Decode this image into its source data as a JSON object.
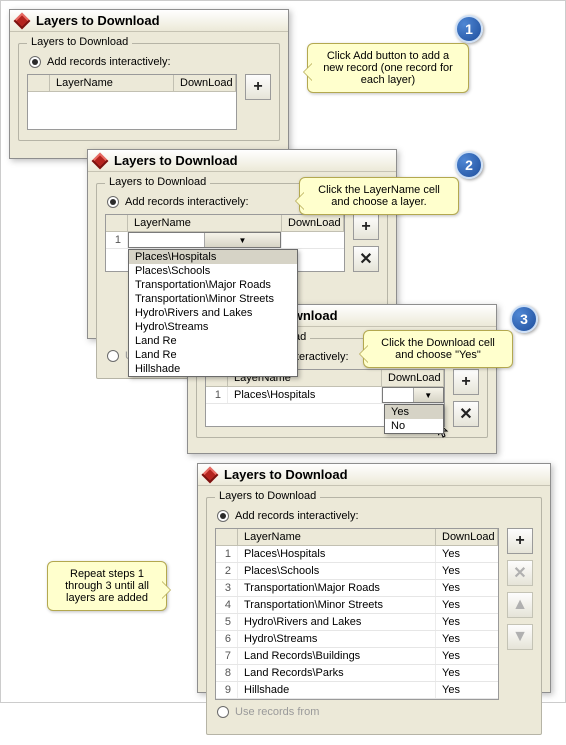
{
  "dialog_title": "Layers to Download",
  "group_label": "Layers to Download",
  "radio_add_label": "Add records interactively:",
  "radio_use_label": "Use records from",
  "columns": {
    "layer": "LayerName",
    "download": "DownLoad"
  },
  "buttons": {
    "add": "+",
    "delete": "✕",
    "up": "▲",
    "down": "▼"
  },
  "steps": {
    "s1": {
      "num": "1",
      "callout": "Click Add button to add a new record (one record for each layer)"
    },
    "s2": {
      "num": "2",
      "callout": "Click the LayerName cell and choose a layer."
    },
    "s3": {
      "num": "3",
      "callout": "Click the Download cell and choose \"Yes\""
    },
    "s4": {
      "callout": "Repeat steps 1 through 3 until all layers are added"
    }
  },
  "layer_dropdown": {
    "options": [
      "Places\\Hospitals",
      "Places\\Schools",
      "Transportation\\Major Roads",
      "Transportation\\Minor Streets",
      "Hydro\\Rivers and Lakes",
      "Hydro\\Streams",
      "Land Re",
      "Land Re",
      "Hillshade"
    ]
  },
  "download_dropdown": {
    "options": [
      "Yes",
      "No"
    ]
  },
  "step3_row": {
    "num": "1",
    "layer": "Places\\Hospitals",
    "download": ""
  },
  "final_rows": [
    {
      "num": "1",
      "layer": "Places\\Hospitals",
      "download": "Yes"
    },
    {
      "num": "2",
      "layer": "Places\\Schools",
      "download": "Yes"
    },
    {
      "num": "3",
      "layer": "Transportation\\Major Roads",
      "download": "Yes"
    },
    {
      "num": "4",
      "layer": "Transportation\\Minor Streets",
      "download": "Yes"
    },
    {
      "num": "5",
      "layer": "Hydro\\Rivers and Lakes",
      "download": "Yes"
    },
    {
      "num": "6",
      "layer": "Hydro\\Streams",
      "download": "Yes"
    },
    {
      "num": "7",
      "layer": "Land Records\\Buildings",
      "download": "Yes"
    },
    {
      "num": "8",
      "layer": "Land Records\\Parks",
      "download": "Yes"
    },
    {
      "num": "9",
      "layer": "Hillshade",
      "download": "Yes"
    }
  ]
}
